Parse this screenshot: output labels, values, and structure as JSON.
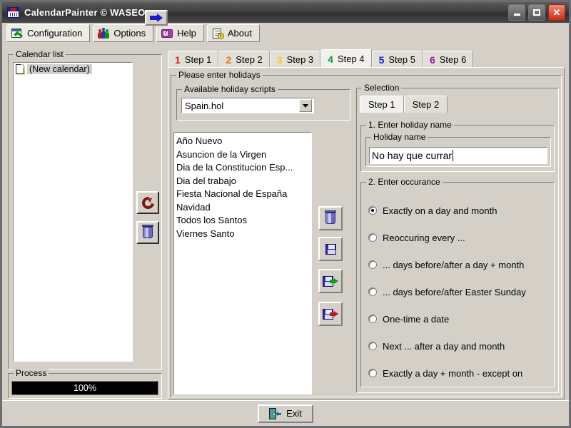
{
  "window": {
    "title": "CalendarPainter © WASEO",
    "app_icon": "calendar-icon",
    "minimize_label": "Minimize",
    "maximize_label": "Maximize",
    "close_label": "✕"
  },
  "main_tabs": [
    {
      "label": "Configuration",
      "icon": "config-wrench-icon",
      "active": true
    },
    {
      "label": "Options",
      "icon": "people-icon",
      "active": false
    },
    {
      "label": "Help",
      "icon": "book-question-icon",
      "active": false
    },
    {
      "label": "About",
      "icon": "document-info-icon",
      "active": false
    }
  ],
  "calendar_list": {
    "group_label": "Calendar list",
    "items": [
      {
        "label": "(New calendar)",
        "icon": "document-icon",
        "selected": true
      }
    ],
    "buttons": [
      {
        "name": "refresh-calendar-button",
        "icon": "refresh-icon"
      },
      {
        "name": "delete-calendar-button",
        "icon": "trash-icon"
      }
    ]
  },
  "process": {
    "group_label": "Process",
    "value_text": "100%",
    "percent": 100,
    "bar_color": "#000000",
    "text_color": "#ffffff"
  },
  "step_tabs": [
    {
      "num": "1",
      "label": "Step 1",
      "color": "#d81818",
      "active": false
    },
    {
      "num": "2",
      "label": "Step 2",
      "color": "#e87818",
      "active": false
    },
    {
      "num": "3",
      "label": "Step 3",
      "color": "#f0d018",
      "active": false
    },
    {
      "num": "4",
      "label": "Step 4",
      "color": "#0d9a3d",
      "active": true
    },
    {
      "num": "5",
      "label": "Step 5",
      "color": "#1818d8",
      "active": false
    },
    {
      "num": "6",
      "label": "Step 6",
      "color": "#9a189a",
      "active": false
    }
  ],
  "holidays_panel": {
    "group_label": "Please enter holidays",
    "scripts": {
      "group_label": "Available holiday scripts",
      "selected": "Spain.hol",
      "dropdown_icon": "chevron-down-icon",
      "add_button_icon": "arrow-right-icon"
    },
    "list": [
      "Año Nuevo",
      "Asuncion de la Virgen",
      "Dia de la Constitucion Esp...",
      "Dia del trabajo",
      "Fiesta Nacional de España",
      "Navidad",
      "Todos los Santos",
      "Viernes Santo"
    ],
    "list_buttons": [
      {
        "name": "delete-holiday-button",
        "icon": "trash-icon"
      },
      {
        "name": "save-holiday-button",
        "icon": "floppy-icon"
      },
      {
        "name": "export-holiday-button",
        "icon": "floppy-export-icon"
      },
      {
        "name": "import-holiday-button",
        "icon": "floppy-import-icon"
      }
    ]
  },
  "selection": {
    "group_label": "Selection",
    "tabs": [
      {
        "label": "Step 1",
        "active": true
      },
      {
        "label": "Step 2",
        "active": false
      }
    ],
    "name_section": {
      "group_label": "1. Enter holiday name",
      "field_label": "Holiday name",
      "value": "No hay que currar",
      "placeholder": ""
    },
    "occurance_section": {
      "group_label": "2. Enter occurance",
      "options": [
        {
          "label": "Exactly on a day and month",
          "selected": true
        },
        {
          "label": "Reoccuring every ...",
          "selected": false
        },
        {
          "label": "... days before/after a day + month",
          "selected": false
        },
        {
          "label": "... days before/after Easter Sunday",
          "selected": false
        },
        {
          "label": "One-time a date",
          "selected": false
        },
        {
          "label": "Next ... after a day and month",
          "selected": false
        },
        {
          "label": "Exactly a day + month - except on",
          "selected": false
        }
      ]
    }
  },
  "footer": {
    "exit_label": "Exit",
    "exit_icon": "exit-door-icon"
  }
}
